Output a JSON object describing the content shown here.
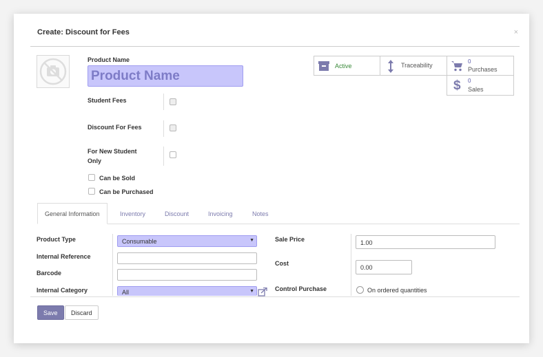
{
  "dialog": {
    "title": "Create: Discount for Fees",
    "close": "×"
  },
  "product": {
    "name_label": "Product Name",
    "name_placeholder": "Product Name"
  },
  "checkboxes": {
    "student_fees": "Student Fees",
    "discount_for_fees": "Discount For Fees",
    "for_new_student_line1": "For New Student",
    "for_new_student_line2": "Only",
    "can_be_sold": "Can be Sold",
    "can_be_purchased": "Can be Purchased"
  },
  "smart_buttons": {
    "active": "Active",
    "traceability": "Traceability",
    "purchases_count": "0",
    "purchases_label": "Purchases",
    "sales_count": "0",
    "sales_label": "Sales"
  },
  "tabs": [
    {
      "label": "General Information"
    },
    {
      "label": "Inventory"
    },
    {
      "label": "Discount"
    },
    {
      "label": "Invoicing"
    },
    {
      "label": "Notes"
    }
  ],
  "general": {
    "product_type_label": "Product Type",
    "product_type_value": "Consumable",
    "internal_reference_label": "Internal Reference",
    "internal_reference_value": "",
    "barcode_label": "Barcode",
    "barcode_value": "",
    "internal_category_label": "Internal Category",
    "internal_category_value": "All",
    "sale_price_label": "Sale Price",
    "sale_price_value": "1.00",
    "cost_label": "Cost",
    "cost_value": "0.00",
    "control_purchase_label": "Control Purchase",
    "control_purchase_option": "On ordered quantities"
  },
  "footer": {
    "save": "Save",
    "discard": "Discard"
  },
  "colors": {
    "accent": "#7c7bad",
    "active_green": "#3a8a3a",
    "required_field": "#c8c6fb"
  }
}
